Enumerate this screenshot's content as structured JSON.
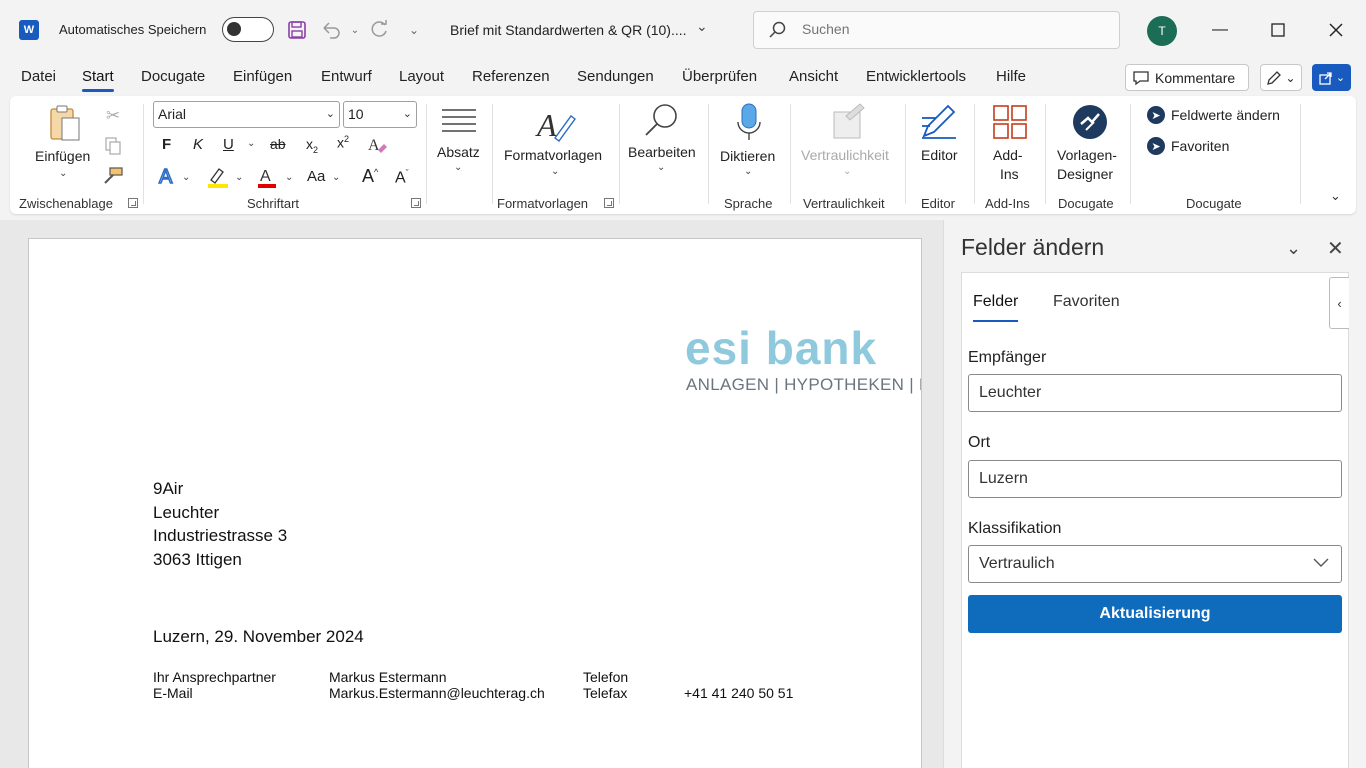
{
  "titlebar": {
    "autosave_label": "Automatisches Speichern",
    "doc_title": "Brief mit Standardwerten & QR (10)....",
    "search_placeholder": "Suchen",
    "avatar_initial": "T"
  },
  "menu": {
    "tabs": [
      "Datei",
      "Start",
      "Docugate",
      "Einfügen",
      "Entwurf",
      "Layout",
      "Referenzen",
      "Sendungen",
      "Überprüfen",
      "Ansicht",
      "Entwicklertools",
      "Hilfe"
    ],
    "active": "Start",
    "kommentare_label": "Kommentare"
  },
  "ribbon": {
    "clipboard": {
      "paste_label": "Einfügen",
      "group_label": "Zwischenablage"
    },
    "font": {
      "font_name": "Arial",
      "font_size": "10",
      "group_label": "Schriftart",
      "bold": "F",
      "italic": "K",
      "underline": "U",
      "strike": "ab",
      "aa": "Aa"
    },
    "paragraph": {
      "label": "Absatz"
    },
    "styles": {
      "label": "Formatvorlagen",
      "group_label": "Formatvorlagen"
    },
    "editing": {
      "label": "Bearbeiten"
    },
    "voice": {
      "label": "Diktieren",
      "group_label": "Sprache"
    },
    "sensitivity": {
      "label": "Vertraulichkeit",
      "group_label": "Vertraulichkeit"
    },
    "editor": {
      "label": "Editor",
      "group_label": "Editor"
    },
    "addins": {
      "label_line1": "Add-",
      "label_line2": "Ins",
      "group_label": "Add-Ins"
    },
    "designer": {
      "label_line1": "Vorlagen-",
      "label_line2": "Designer",
      "group_label": "Docugate"
    },
    "docugate": {
      "item1": "Feldwerte ändern",
      "item2": "Favoriten",
      "group_label": "Docugate"
    }
  },
  "document": {
    "logo_text": "esi bank",
    "logo_tagline": "ANLAGEN | HYPOTHEKEN | K",
    "address": [
      "9Air",
      "Leuchter",
      "Industriestrasse 3",
      "3063 Ittigen"
    ],
    "date": "Luzern, 29. November 2024",
    "contact": {
      "label1": "Ihr Ansprechpartner",
      "label2": "E-Mail",
      "name": "Markus Estermann",
      "email": "Markus.Estermann@leuchterag.ch",
      "phone_label": "Telefon",
      "fax_label": "Telefax",
      "fax_value": "+41 41 240 50 51"
    }
  },
  "pane": {
    "title": "Felder ändern",
    "tabs": [
      "Felder",
      "Favoriten"
    ],
    "fields": {
      "empfaenger_label": "Empfänger",
      "empfaenger_value": "Leuchter",
      "ort_label": "Ort",
      "ort_value": "Luzern",
      "klass_label": "Klassifikation",
      "klass_value": "Vertraulich"
    },
    "update_label": "Aktualisierung"
  },
  "colors": {
    "accent": "#185abd",
    "button": "#0f6cbd",
    "logo": "#8ec9dd",
    "avatar": "#1b6d56"
  }
}
